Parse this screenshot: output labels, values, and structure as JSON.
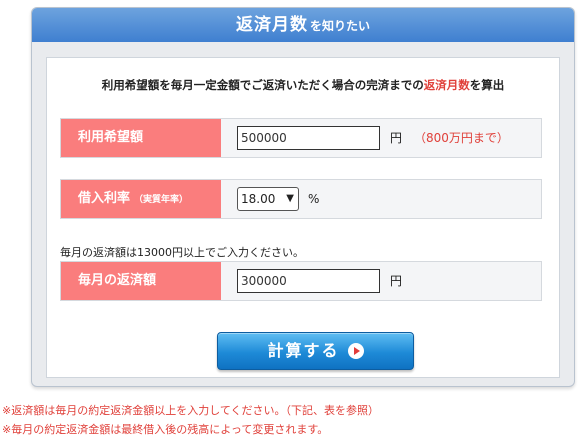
{
  "header": {
    "title_main": "返済月数",
    "title_sub": "を知りたい"
  },
  "lead": {
    "text_before": "利用希望額を毎月一定金額でご返済いただく場合の完済までの",
    "accent": "返済月数",
    "text_after": "を算出"
  },
  "loan_amount": {
    "label": "利用希望額",
    "value": "500000",
    "unit": "円",
    "note": "（800万円まで）"
  },
  "interest_rate": {
    "label": "借入利率",
    "label_small": "（実質年率）",
    "selected": "18.00",
    "unit": "%"
  },
  "monthly_payment": {
    "hint": "毎月の返済額は13000円以上でご入力ください。",
    "label": "毎月の返済額",
    "value": "300000",
    "unit": "円"
  },
  "calculate_button": {
    "label": "計算する"
  },
  "footnotes": [
    "※返済額は毎月の約定返済金額以上を入力してください。（下記、表を参照）",
    "※毎月の約定返済金額は最終借入後の残高によって変更されます。"
  ],
  "colors": {
    "header_blue": "#4a88d4",
    "label_pink": "#fa7d7d",
    "accent_red": "#e0403a",
    "button_blue": "#1e8ad7"
  },
  "icons": {
    "select_arrow": "chevron-down-icon",
    "button_arrow": "play-circle-icon"
  }
}
